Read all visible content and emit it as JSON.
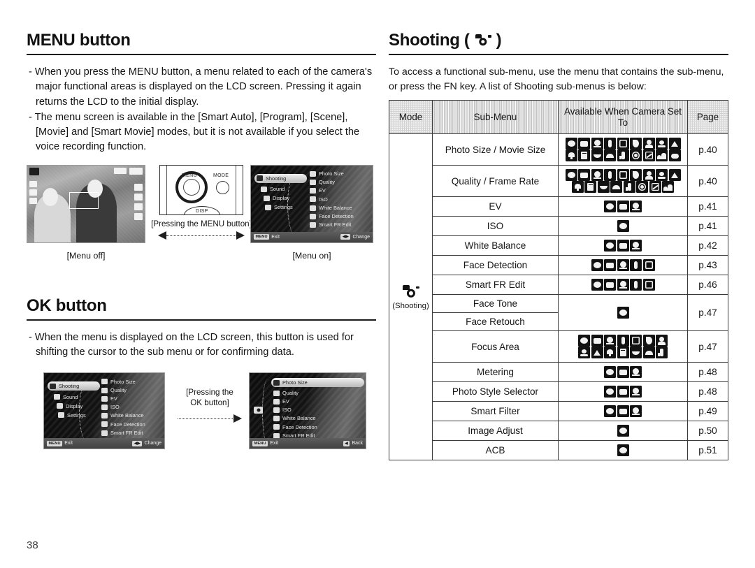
{
  "page_number": "38",
  "left_column": {
    "menu_section": {
      "title": "MENU button",
      "bullets": [
        "When you press the MENU button, a menu related to each of the camera's major functional areas is displayed on the LCD screen. Pressing it again returns the LCD to the initial display.",
        "The menu screen is available in the [Smart Auto], [Program], [Scene], [Movie] and [Smart Movie] modes, but it is not available if you select the voice recording function."
      ],
      "figure": {
        "caption_left": "[Menu off]",
        "caption_right": "[Menu on]",
        "caption_middle": "[Pressing the MENU button]",
        "button_labels": {
          "menu": "MENU",
          "mode": "MODE",
          "disp": "DISP"
        },
        "menu_screen": {
          "left_items": [
            "Shooting",
            "Sound",
            "Display",
            "Settings"
          ],
          "selected_left": "Shooting",
          "right_items": [
            "Photo Size",
            "Quality",
            "EV",
            "ISO",
            "White Balance",
            "Face Detection",
            "Smart FR Edit"
          ],
          "bar_left_key": "MENU",
          "bar_left_label": "Exit",
          "bar_right_label": "Change"
        }
      }
    },
    "ok_section": {
      "title": "OK button",
      "bullets": [
        "When the menu is displayed on the LCD screen, this button is used for shifting the cursor to the sub menu or for confirming data."
      ],
      "figure": {
        "caption_middle_line1": "[Pressing the",
        "caption_middle_line2": "OK button]",
        "screen_left": {
          "left_items": [
            "Shooting",
            "Sound",
            "Display",
            "Settings"
          ],
          "selected_left": "Shooting",
          "right_items": [
            "Photo Size",
            "Quality",
            "EV",
            "ISO",
            "White Balance",
            "Face Detection",
            "Smart FR Edit"
          ],
          "bar_left_key": "MENU",
          "bar_left_label": "Exit",
          "bar_right_label": "Change"
        },
        "screen_right": {
          "right_items": [
            "Photo Size",
            "Quality",
            "EV",
            "ISO",
            "White Balance",
            "Face Detection",
            "Smart FR Edit"
          ],
          "selected_right": "Photo Size",
          "bar_left_key": "MENU",
          "bar_left_label": "Exit",
          "bar_right_label": "Back"
        }
      }
    }
  },
  "right_column": {
    "title": "Shooting (",
    "title_suffix": ")",
    "title_icon": "camera-icon",
    "intro": "To access a functional sub-menu, use the menu that contains the sub-menu, or press the FN key. A list of Shooting sub-menus is below:",
    "table": {
      "headers": [
        "Mode",
        "Sub-Menu",
        "Available When Camera Set To",
        "Page"
      ],
      "mode_label": "(Shooting)",
      "mode_icon": "camera-icon",
      "rows": [
        {
          "sub_menu": "Photo Size / Movie Size",
          "icon_count_row1": 9,
          "icon_count_row2": 9,
          "page": "p.40"
        },
        {
          "sub_menu": "Quality / Frame Rate",
          "icon_count_row1": 9,
          "icon_count_row2": 8,
          "page": "p.40"
        },
        {
          "sub_menu": "EV",
          "icon_count_row1": 3,
          "icon_count_row2": 0,
          "page": "p.41"
        },
        {
          "sub_menu": "ISO",
          "icon_count_row1": 1,
          "icon_count_row2": 0,
          "page": "p.41"
        },
        {
          "sub_menu": "White Balance",
          "icon_count_row1": 3,
          "icon_count_row2": 0,
          "page": "p.42"
        },
        {
          "sub_menu": "Face Detection",
          "icon_count_row1": 5,
          "icon_count_row2": 0,
          "page": "p.43"
        },
        {
          "sub_menu": "Smart FR Edit",
          "icon_count_row1": 5,
          "icon_count_row2": 0,
          "page": "p.46"
        },
        {
          "sub_menu": "Face Tone",
          "icon_count_row1": 1,
          "icon_count_row2": 0,
          "page": "p.47",
          "merged_with_next": true
        },
        {
          "sub_menu": "Face Retouch",
          "icon_count_row1": 0,
          "icon_count_row2": 0,
          "page": ""
        },
        {
          "sub_menu": "Focus Area",
          "icon_count_row1": 7,
          "icon_count_row2": 7,
          "page": "p.47"
        },
        {
          "sub_menu": "Metering",
          "icon_count_row1": 3,
          "icon_count_row2": 0,
          "page": "p.48"
        },
        {
          "sub_menu": "Photo Style Selector",
          "icon_count_row1": 3,
          "icon_count_row2": 0,
          "page": "p.48"
        },
        {
          "sub_menu": "Smart Filter",
          "icon_count_row1": 3,
          "icon_count_row2": 0,
          "page": "p.49"
        },
        {
          "sub_menu": "Image Adjust",
          "icon_count_row1": 1,
          "icon_count_row2": 0,
          "page": "p.50"
        },
        {
          "sub_menu": "ACB",
          "icon_count_row1": 1,
          "icon_count_row2": 0,
          "page": "p.51"
        }
      ]
    }
  },
  "colors": {
    "ink": "#161616",
    "rule": "#1a1a1a",
    "header_fill": "#d3d3d3",
    "chip_fill": "#121212"
  }
}
